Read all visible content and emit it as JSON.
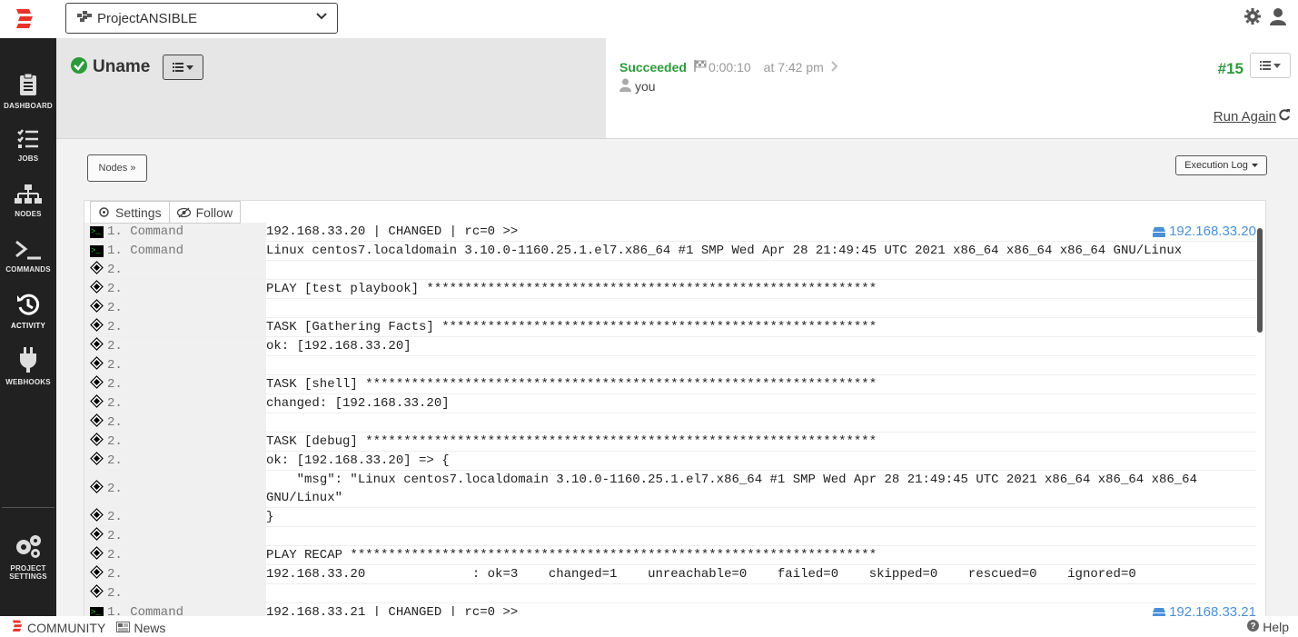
{
  "header": {
    "project_name": "ProjectANSIBLE"
  },
  "sidebar": {
    "items": [
      {
        "label": "DASHBOARD"
      },
      {
        "label": "JOBS"
      },
      {
        "label": "NODES"
      },
      {
        "label": "COMMANDS"
      },
      {
        "label": "ACTIVITY"
      },
      {
        "label": "WEBHOOKS"
      }
    ],
    "settings_line1": "PROJECT",
    "settings_line2": "SETTINGS"
  },
  "job": {
    "name": "Uname",
    "status": "Succeeded",
    "duration": "0:00:10",
    "time": "at 7:42 pm",
    "user": "you",
    "run_number": "#15",
    "run_again": "Run Again"
  },
  "controls": {
    "nodes_button": "Nodes »",
    "exec_log_button": "Execution Log",
    "settings_button": "Settings",
    "follow_button": "Follow"
  },
  "log_rows": [
    {
      "kind": "cmd",
      "step": "1. Command",
      "text": "192.168.33.20 | CHANGED | rc=0 >>",
      "node": "192.168.33.20"
    },
    {
      "kind": "cmd",
      "step": "1. Command",
      "text": "Linux centos7.localdomain 3.10.0-1160.25.1.el7.x86_64 #1 SMP Wed Apr 28 21:49:45 UTC 2021 x86_64 x86_64 x86_64 GNU/Linux"
    },
    {
      "kind": "step",
      "step": "2.",
      "text": ""
    },
    {
      "kind": "step",
      "step": "2.",
      "text": "PLAY [test playbook] ***********************************************************"
    },
    {
      "kind": "step",
      "step": "2.",
      "text": ""
    },
    {
      "kind": "step",
      "step": "2.",
      "text": "TASK [Gathering Facts] *********************************************************"
    },
    {
      "kind": "step",
      "step": "2.",
      "text": "ok: [192.168.33.20]"
    },
    {
      "kind": "step",
      "step": "2.",
      "text": ""
    },
    {
      "kind": "step",
      "step": "2.",
      "text": "TASK [shell] *******************************************************************"
    },
    {
      "kind": "step",
      "step": "2.",
      "text": "changed: [192.168.33.20]"
    },
    {
      "kind": "step",
      "step": "2.",
      "text": ""
    },
    {
      "kind": "step",
      "step": "2.",
      "text": "TASK [debug] *******************************************************************"
    },
    {
      "kind": "step",
      "step": "2.",
      "text": "ok: [192.168.33.20] => {"
    },
    {
      "kind": "step",
      "step": "2.",
      "text": "    \"msg\": \"Linux centos7.localdomain 3.10.0-1160.25.1.el7.x86_64 #1 SMP Wed Apr 28 21:49:45 UTC 2021 x86_64 x86_64 x86_64\nGNU/Linux\""
    },
    {
      "kind": "step",
      "step": "2.",
      "text": "}"
    },
    {
      "kind": "step",
      "step": "2.",
      "text": ""
    },
    {
      "kind": "step",
      "step": "2.",
      "text": "PLAY RECAP *********************************************************************"
    },
    {
      "kind": "step",
      "step": "2.",
      "text": "192.168.33.20              : ok=3    changed=1    unreachable=0    failed=0    skipped=0    rescued=0    ignored=0"
    },
    {
      "kind": "step",
      "step": "2.",
      "text": ""
    },
    {
      "kind": "cmd",
      "step": "1. Command",
      "text": "192.168.33.21 | CHANGED | rc=0 >>",
      "node": "192.168.33.21"
    }
  ],
  "footer": {
    "community": "COMMUNITY",
    "news": "News",
    "help": "Help"
  },
  "colors": {
    "success": "#2d9a3a",
    "sidebar": "#212121",
    "link": "#4a90d9",
    "brand": "#e8332a"
  }
}
